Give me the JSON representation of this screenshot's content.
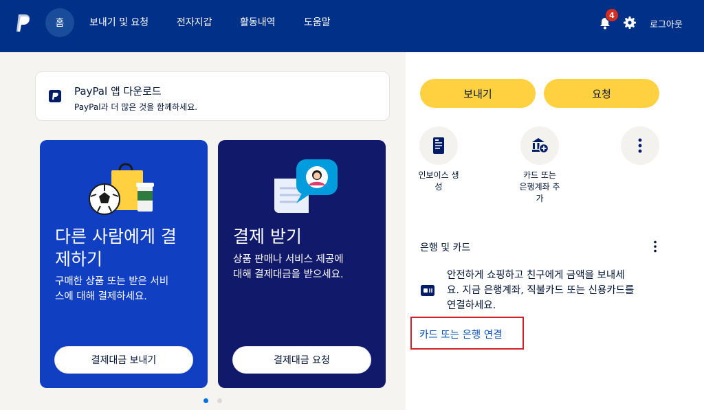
{
  "header": {
    "nav": {
      "home": "홈",
      "send_request": "보내기 및 요청",
      "wallet": "전자지갑",
      "activity": "활동내역",
      "help": "도움말"
    },
    "notification_count": "4",
    "logout": "로그아웃"
  },
  "app_banner": {
    "title": "PayPal 앱 다운로드",
    "subtitle": "PayPal과 더 많은 것을 함께하세요."
  },
  "cards": [
    {
      "title_lines": [
        "다른 사람에게 결",
        "제하기"
      ],
      "desc_lines": [
        "구매한 상품 또는 받은 서비",
        "스에 대해 결제하세요."
      ],
      "button": "결제대금 보내기"
    },
    {
      "title_lines": [
        "결제 받기"
      ],
      "desc_lines": [
        "상품 판매나 서비스 제공에",
        "대해 결제대금을 받으세요."
      ],
      "button": "결제대금 요청"
    }
  ],
  "actions": {
    "send": "보내기",
    "request": "요청",
    "invoice_lines": [
      "인보이스 생",
      "성"
    ],
    "add_card_lines": [
      "카드 또는",
      "은행계좌 추",
      "가"
    ]
  },
  "bank_section": {
    "title": "은행 및 카드",
    "info_lines": [
      "안전하게 쇼핑하고 친구에게 금액을 보내세",
      "요. 지금 은행계좌, 직불카드 또는 신용카드를",
      "연결하세요."
    ],
    "link": "카드 또는 은행 연결"
  },
  "colors": {
    "header_bg": "#003087",
    "card1_bg": "#1040c1",
    "card2_bg": "#11196b",
    "accent_yellow": "#ffd140",
    "link_blue": "#0551b5",
    "highlight_red": "#d3232a"
  },
  "carousel": {
    "active_index": 0,
    "count": 2
  }
}
